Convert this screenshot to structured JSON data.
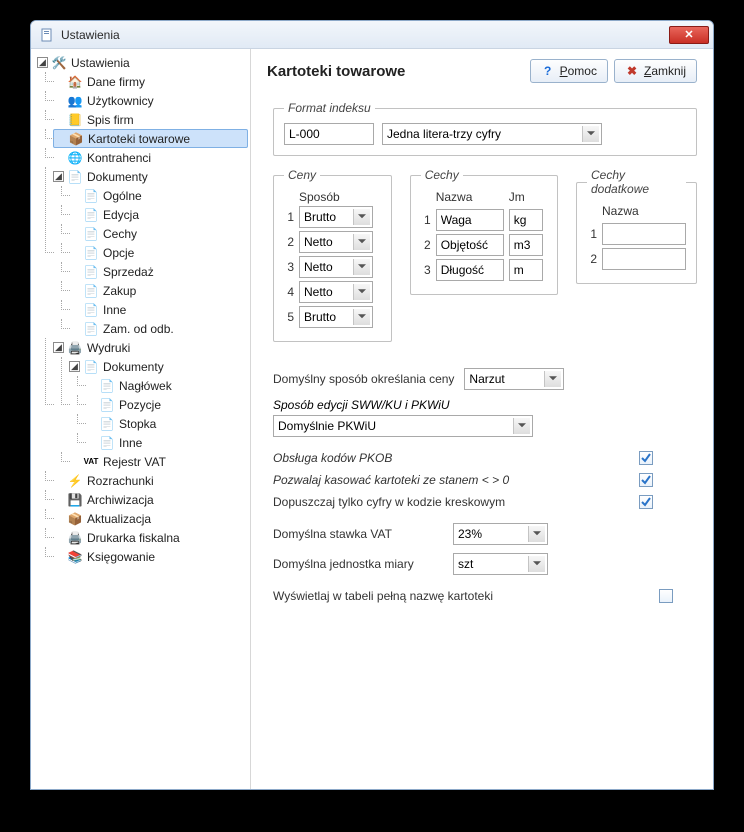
{
  "window": {
    "title": "Ustawienia"
  },
  "buttons": {
    "help": "Pomoc",
    "close": "Zamknij"
  },
  "page": {
    "title": "Kartoteki towarowe"
  },
  "tree": {
    "root": "Ustawienia",
    "daneFirmy": "Dane firmy",
    "uzytkownicy": "Użytkownicy",
    "spisFirm": "Spis firm",
    "kartoteki": "Kartoteki towarowe",
    "kontrahenci": "Kontrahenci",
    "dokumenty": "Dokumenty",
    "dok_ogolne": "Ogólne",
    "dok_edycja": "Edycja",
    "dok_cechy": "Cechy",
    "dok_opcje": "Opcje",
    "dok_sprzedaz": "Sprzedaż",
    "dok_zakup": "Zakup",
    "dok_inne": "Inne",
    "dok_zam": "Zam. od odb.",
    "wydruki": "Wydruki",
    "wyd_dokumenty": "Dokumenty",
    "wyd_naglowek": "Nagłówek",
    "wyd_pozycje": "Pozycje",
    "wyd_stopka": "Stopka",
    "wyd_inne": "Inne",
    "rejestrVat": "Rejestr VAT",
    "rozrachunki": "Rozrachunki",
    "archiwizacja": "Archiwizacja",
    "aktualizacja": "Aktualizacja",
    "drukarka": "Drukarka fiskalna",
    "ksiegowanie": "Księgowanie"
  },
  "format": {
    "legend": "Format indeksu",
    "value": "L-000",
    "desc": "Jedna litera-trzy cyfry"
  },
  "ceny": {
    "legend": "Ceny",
    "head": "Sposób",
    "r1": "Brutto",
    "r2": "Netto",
    "r3": "Netto",
    "r4": "Netto",
    "r5": "Brutto"
  },
  "cechy": {
    "legend": "Cechy",
    "hNazwa": "Nazwa",
    "hJm": "Jm",
    "n1": "Waga",
    "j1": "kg",
    "n2": "Objętość",
    "j2": "m3",
    "n3": "Długość",
    "j3": "m"
  },
  "dod": {
    "legend": "Cechy dodatkowe",
    "hNazwa": "Nazwa",
    "v1": "",
    "v2": ""
  },
  "defPrice": {
    "label": "Domyślny sposób określania ceny",
    "value": "Narzut"
  },
  "sww": {
    "label": "Sposób edycji SWW/KU i PKWiU",
    "value": "Domyślnie PKWiU"
  },
  "chk1": {
    "label": "Obsługa kodów PKOB",
    "checked": true
  },
  "chk2": {
    "label": "Pozwalaj kasować kartoteki ze stanem < > 0",
    "checked": true
  },
  "chk3": {
    "label": "Dopuszczaj tylko cyfry w kodzie kreskowym",
    "checked": true
  },
  "vat": {
    "label": "Domyślna stawka VAT",
    "value": "23%"
  },
  "jm": {
    "label": "Domyślna jednostka miary",
    "value": "szt"
  },
  "chk4": {
    "label": "Wyświetlaj w tabeli pełną nazwę kartoteki",
    "checked": false
  }
}
